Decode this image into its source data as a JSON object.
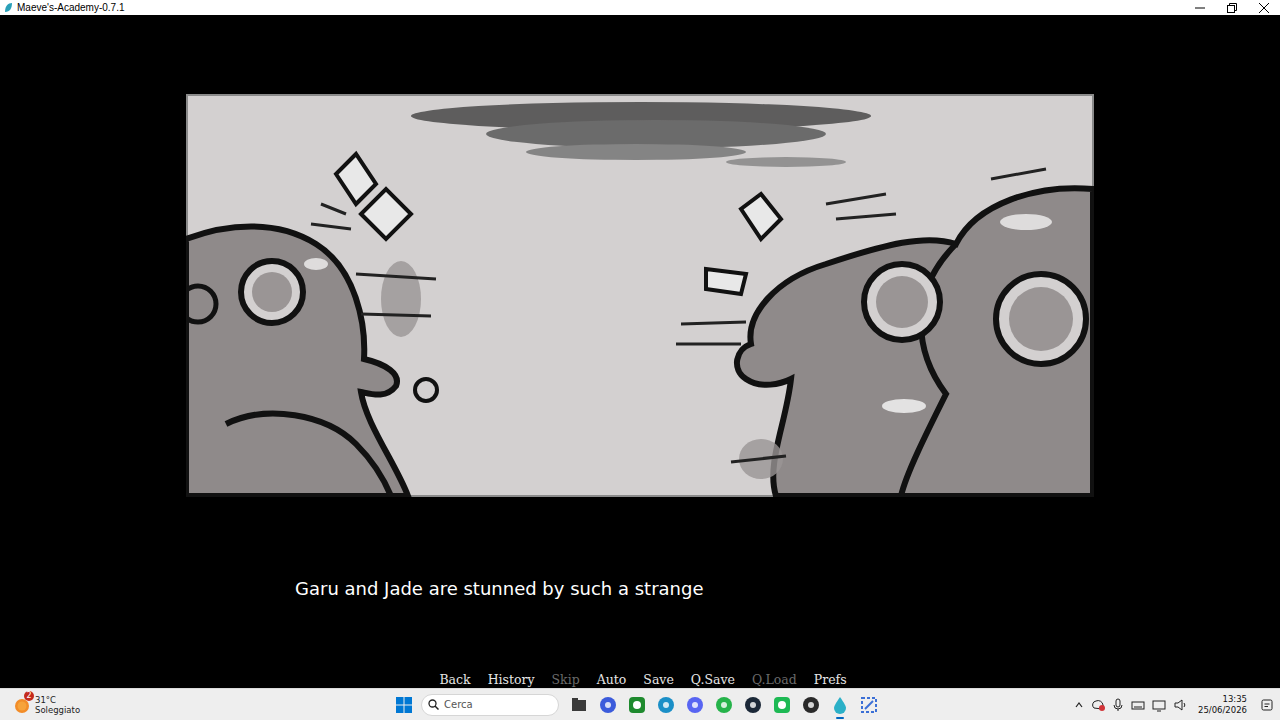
{
  "window": {
    "title": "Maeve's-Academy-0.7.1"
  },
  "dialogue": {
    "text": "Garu and Jade are stunned by such a strange"
  },
  "quick_menu": [
    {
      "label": "Back",
      "disabled": false
    },
    {
      "label": "History",
      "disabled": false
    },
    {
      "label": "Skip",
      "disabled": true
    },
    {
      "label": "Auto",
      "disabled": false
    },
    {
      "label": "Save",
      "disabled": false
    },
    {
      "label": "Q.Save",
      "disabled": false
    },
    {
      "label": "Q.Load",
      "disabled": true
    },
    {
      "label": "Prefs",
      "disabled": false
    }
  ],
  "taskbar": {
    "weather": {
      "badge": "2",
      "temperature": "31°C",
      "condition": "Soleggiato"
    },
    "search": {
      "placeholder": "Cerca"
    },
    "apps": [
      {
        "kind": "folder",
        "color": "#3a3a3a",
        "running": false
      },
      {
        "kind": "circle",
        "color": "#3b5bdb",
        "running": false
      },
      {
        "kind": "square",
        "color": "#1e8a2e",
        "running": false
      },
      {
        "kind": "circle",
        "color": "#1b8fc7",
        "running": false
      },
      {
        "kind": "circle",
        "color": "#5865f2",
        "running": false
      },
      {
        "kind": "circle",
        "color": "#25b34a",
        "running": false
      },
      {
        "kind": "circle",
        "color": "#1b2838",
        "running": false
      },
      {
        "kind": "square",
        "color": "#1db954",
        "running": false
      },
      {
        "kind": "circle",
        "color": "#2a2a2a",
        "running": false
      },
      {
        "kind": "drop",
        "color": "#2bb0c7",
        "running": true
      },
      {
        "kind": "snip",
        "color": "#3b6fd6",
        "running": false
      }
    ],
    "clock": {
      "time": "13:35",
      "date": "25/06/2026"
    }
  }
}
